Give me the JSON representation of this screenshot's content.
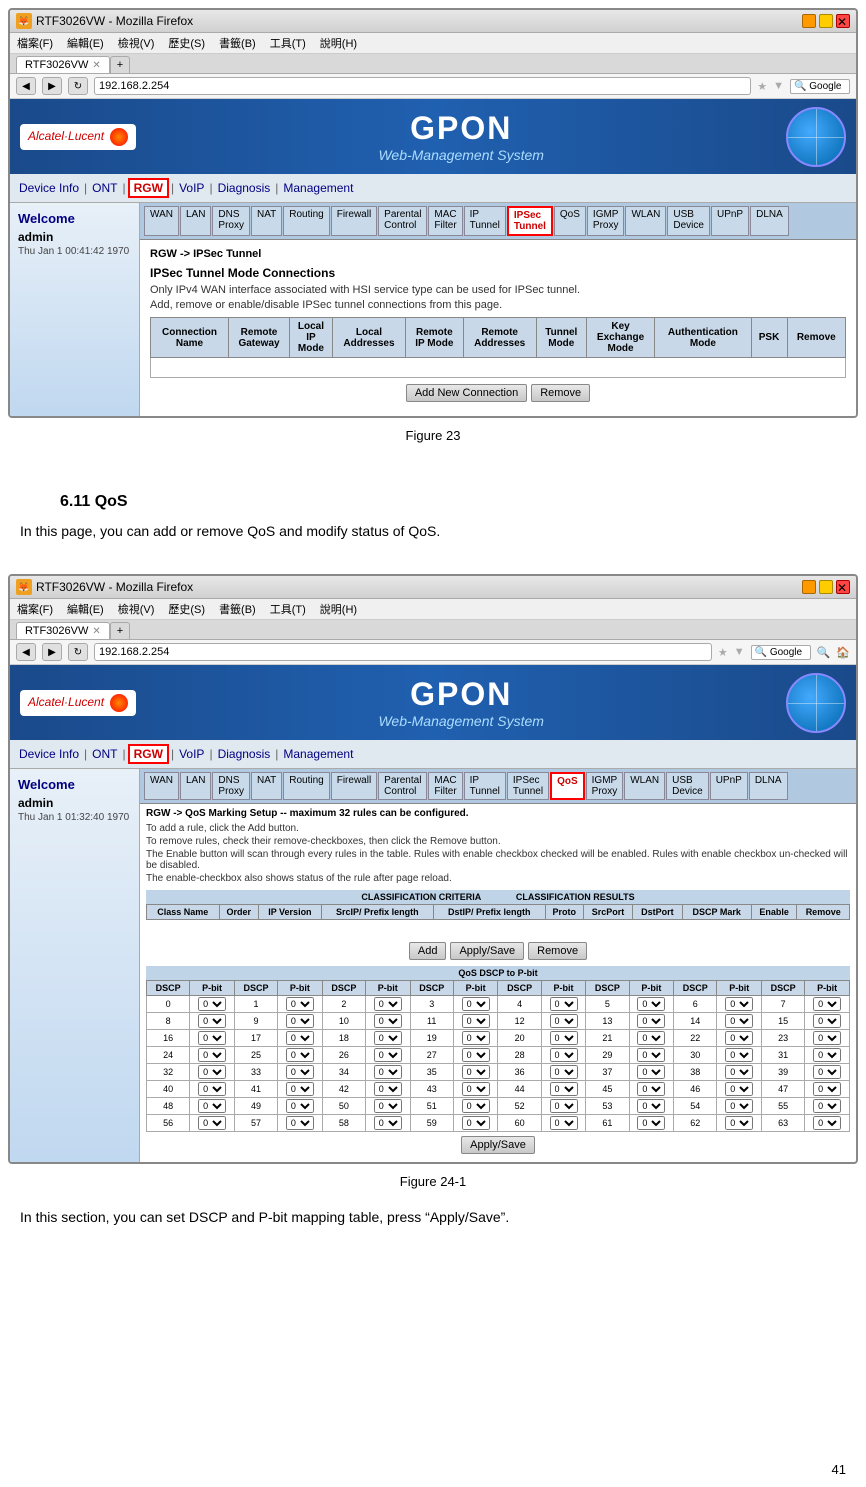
{
  "page": {
    "number": "41"
  },
  "figure23": {
    "browser": {
      "title": "RTF3026VW - Mozilla Firefox",
      "tab_label": "RTF3026VW",
      "address": "192.168.2.254",
      "menu_items": [
        "檔案(F)",
        "編輯(E)",
        "檢視(V)",
        "歷史(S)",
        "書籤(B)",
        "工具(T)",
        "說明(H)"
      ]
    },
    "gpon": {
      "brand": "Alcatel·Lucent",
      "title": "GPON",
      "subtitle": "Web-Management System"
    },
    "nav": {
      "items": [
        "Device Info",
        "ONT",
        "RGW",
        "VoIP",
        "Diagnosis",
        "Management"
      ]
    },
    "sidebar": {
      "welcome": "Welcome",
      "user": "admin",
      "time": "Thu Jan 1 00:41:42 1970"
    },
    "subnav": {
      "items": [
        "WAN",
        "LAN",
        "DNS Proxy",
        "NAT",
        "Routing",
        "Firewall",
        "Parental Control",
        "MAC Filter",
        "IP Tunnel",
        "IPSec Tunnel",
        "QoS",
        "IGMP Proxy",
        "WLAN",
        "USB Device",
        "UPnP",
        "DLNA"
      ]
    },
    "content": {
      "breadcrumb": "RGW -> IPSec Tunnel",
      "page_title": "IPSec Tunnel Mode Connections",
      "info1": "Only IPv4 WAN interface associated with HSI service type can be used for IPSec tunnel.",
      "info2": "Add, remove or enable/disable IPSec tunnel connections from this page.",
      "table_headers": [
        "Connection Name",
        "Remote Gateway",
        "Local IP Mode",
        "Local Addresses",
        "Remote IP Mode",
        "Remote Addresses",
        "Tunnel Mode",
        "Key Exchange Mode",
        "Authentication Mode",
        "PSK",
        "Remove"
      ],
      "btn_add": "Add New Connection",
      "btn_remove": "Remove"
    }
  },
  "figure23_caption": "Figure 23",
  "section_611": {
    "heading": "6.11  QoS",
    "body_text": "In this page, you can add or remove QoS and modify status of QoS."
  },
  "figure241": {
    "browser": {
      "title": "RTF3026VW - Mozilla Firefox",
      "tab_label": "RTF3026VW",
      "address": "192.168.2.254",
      "menu_items": [
        "檔案(F)",
        "編輯(E)",
        "檢視(V)",
        "歷史(S)",
        "書籤(B)",
        "工具(T)",
        "說明(H)"
      ]
    },
    "gpon": {
      "brand": "Alcatel·Lucent",
      "title": "GPON",
      "subtitle": "Web-Management System"
    },
    "nav": {
      "items": [
        "Device Info",
        "ONT",
        "RGW",
        "VoIP",
        "Diagnosis",
        "Management"
      ]
    },
    "sidebar": {
      "welcome": "Welcome",
      "user": "admin",
      "time": "Thu Jan 1 01:32:40 1970"
    },
    "subnav": {
      "items": [
        "WAN",
        "LAN",
        "DNS Proxy",
        "NAT",
        "Routing",
        "Firewall",
        "Parental Control",
        "MAC Filter",
        "IP Tunnel",
        "IPSec Tunnel",
        "QoS",
        "IGMP Proxy",
        "WLAN",
        "USB Device",
        "UPnP",
        "DLNA"
      ]
    },
    "content": {
      "breadcrumb": "RGW -> QoS Marking Setup -- maximum 32 rules can be configured.",
      "info1": "To add a rule, click the Add button.",
      "info2": "To remove rules, check their remove-checkboxes, then click the Remove button.",
      "info3": "The Enable button will scan through every rules in the table. Rules with enable checkbox checked will be enabled. Rules with enable checkbox un-checked will be disabled.",
      "info4": "The enable-checkbox also shows status of the rule after page reload.",
      "classification_headers": [
        "Class Name",
        "Order",
        "IP Version",
        "SrcIP/ Prefix length",
        "DstIP/ Prefix length",
        "Proto",
        "SrcPort",
        "DstPort",
        "DSCP Mark",
        "Enable",
        "Remove"
      ],
      "btn_add": "Add",
      "btn_apply_save": "Apply/Save",
      "btn_remove": "Remove",
      "dscp_section_title": "QoS DSCP to P-bit",
      "dscp_headers": [
        "DSCP",
        "P-bit",
        "DSCP",
        "P-bit",
        "DSCP",
        "P-bit",
        "DSCP",
        "P-bit",
        "DSCP",
        "P-bit",
        "DSCP",
        "P-bit",
        "DSCP",
        "P-bit",
        "DSCP",
        "P-bit"
      ],
      "btn_final_apply": "Apply/Save"
    }
  },
  "figure241_caption": "Figure 24-1",
  "footer_text": "In this section, you can set DSCP and P-bit mapping table, press “Apply/Save”."
}
